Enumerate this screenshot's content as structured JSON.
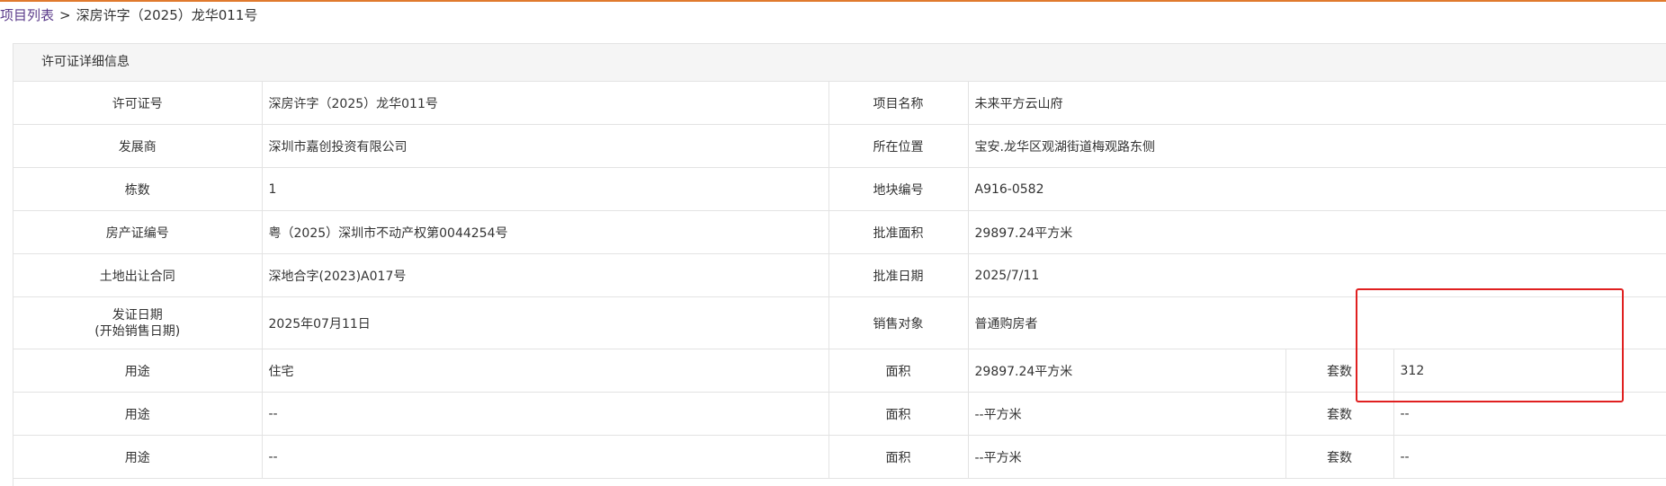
{
  "breadcrumb": {
    "link": "项目列表",
    "separator": ">",
    "current": "深房许字（2025）龙华011号"
  },
  "panel": {
    "title": "许可证详细信息"
  },
  "fields": {
    "permit_no_label": "许可证号",
    "permit_no_value": "深房许字（2025）龙华011号",
    "project_name_label": "项目名称",
    "project_name_value": "未来平方云山府",
    "developer_label": "发展商",
    "developer_value": "深圳市嘉创投资有限公司",
    "location_label": "所在位置",
    "location_value": "宝安.龙华区观湖街道梅观路东侧",
    "buildings_label": "栋数",
    "buildings_value": "1",
    "plot_no_label": "地块编号",
    "plot_no_value": "A916-0582",
    "property_cert_label": "房产证编号",
    "property_cert_value": "粤（2025）深圳市不动产权第0044254号",
    "approved_area_label": "批准面积",
    "approved_area_value": "29897.24平方米",
    "land_contract_label": "土地出让合同",
    "land_contract_value": "深地合字(2023)A017号",
    "approval_date_label": "批准日期",
    "approval_date_value": "2025/7/11",
    "issue_date_label_1": "发证日期",
    "issue_date_label_2": "(开始销售日期)",
    "issue_date_value": "2025年07月11日",
    "sales_target_label": "销售对象",
    "sales_target_value": "普通购房者"
  },
  "usage_rows": [
    {
      "use_label": "用途",
      "use_value": "住宅",
      "area_label": "面积",
      "area_value": "29897.24平方米",
      "units_label": "套数",
      "units_value": "312"
    },
    {
      "use_label": "用途",
      "use_value": "--",
      "area_label": "面积",
      "area_value": "--平方米",
      "units_label": "套数",
      "units_value": "--"
    },
    {
      "use_label": "用途",
      "use_value": "--",
      "area_label": "面积",
      "area_value": "--平方米",
      "units_label": "套数",
      "units_value": "--"
    }
  ],
  "colors": {
    "top_line": "#e07a2e",
    "highlight_border": "#e02020",
    "link": "#5a3a8a"
  }
}
